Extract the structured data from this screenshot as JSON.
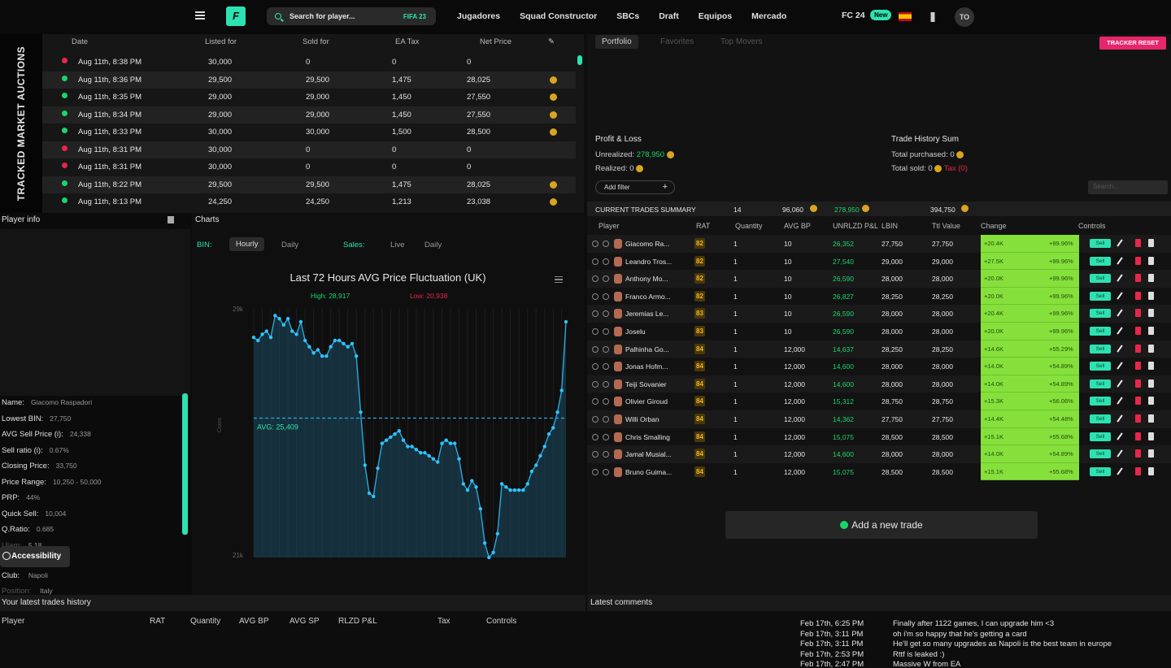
{
  "nav": {
    "search_placeholder": "Search for player...",
    "version": "FIFA 23",
    "links": [
      "Jugadores",
      "Squad Constructor",
      "SBCs",
      "Draft",
      "Equipos",
      "Mercado"
    ],
    "fc_label": "FC 24",
    "new_badge": "New",
    "avatar_initials": "TO"
  },
  "auctions": {
    "banner": "TRACKED MARKET AUCTIONS",
    "headers": [
      "Date",
      "Listed for",
      "Sold for",
      "EA Tax",
      "Net Price"
    ],
    "rows": [
      {
        "status": "red",
        "date": "Aug 11th, 8:38 PM",
        "listed": "30,000",
        "sold": "0",
        "tax": "0",
        "net": "0",
        "coin": false
      },
      {
        "status": "green",
        "date": "Aug 11th, 8:36 PM",
        "listed": "29,500",
        "sold": "29,500",
        "tax": "1,475",
        "net": "28,025",
        "coin": true
      },
      {
        "status": "green",
        "date": "Aug 11th, 8:35 PM",
        "listed": "29,000",
        "sold": "29,000",
        "tax": "1,450",
        "net": "27,550",
        "coin": true
      },
      {
        "status": "green",
        "date": "Aug 11th, 8:34 PM",
        "listed": "29,000",
        "sold": "29,000",
        "tax": "1,450",
        "net": "27,550",
        "coin": true
      },
      {
        "status": "green",
        "date": "Aug 11th, 8:33 PM",
        "listed": "30,000",
        "sold": "30,000",
        "tax": "1,500",
        "net": "28,500",
        "coin": true
      },
      {
        "status": "red",
        "date": "Aug 11th, 8:31 PM",
        "listed": "30,000",
        "sold": "0",
        "tax": "0",
        "net": "0",
        "coin": false
      },
      {
        "status": "red",
        "date": "Aug 11th, 8:31 PM",
        "listed": "30,000",
        "sold": "0",
        "tax": "0",
        "net": "0",
        "coin": false
      },
      {
        "status": "green",
        "date": "Aug 11th, 8:22 PM",
        "listed": "29,500",
        "sold": "29,500",
        "tax": "1,475",
        "net": "28,025",
        "coin": true
      },
      {
        "status": "green",
        "date": "Aug 11th, 8:13 PM",
        "listed": "24,250",
        "sold": "24,250",
        "tax": "1,213",
        "net": "23,038",
        "coin": true
      }
    ]
  },
  "player_info": {
    "title": "Player info",
    "stats": [
      {
        "label": "Name:",
        "value": "Giacomo Raspadori"
      },
      {
        "label": "Lowest BIN:",
        "value": "27,750"
      },
      {
        "label": "AVG Sell Price (i):",
        "value": "24,338"
      },
      {
        "label": "Sell ratio (i):",
        "value": "0.67%"
      },
      {
        "label": "Closing Price:",
        "value": "33,750"
      },
      {
        "label": "Price Range:",
        "value": "10,250 - 50,000"
      },
      {
        "label": "PRP:",
        "value": "44%"
      },
      {
        "label": "Quick Sell:",
        "value": "10,004"
      },
      {
        "label": "Q.Ratio:",
        "value": "0.685"
      },
      {
        "label": "Ulam:",
        "value": "5.18"
      }
    ],
    "club_label": "Club:",
    "club_value": "Napoli",
    "position_label": "Position:",
    "position_value": "Italy",
    "accessibility": "Accessibility"
  },
  "charts": {
    "title": "Charts",
    "bin_label": "BIN:",
    "hourly": "Hourly",
    "daily": "Daily",
    "sales_label": "Sales:",
    "live": "Live",
    "daily2": "Daily",
    "avg_label": "AVG: 25,409",
    "high_label": "High: 28,917",
    "low_label": "Low: 20,938"
  },
  "chart_data": {
    "type": "line",
    "title": "Last 72 Hours AVG Price Fluctuation (UK)",
    "ylabel": "Coins",
    "ylim": [
      20938,
      28917
    ],
    "y_ticks": [
      "29k",
      "21k"
    ],
    "avg": 25409,
    "series": [
      {
        "values": [
          28000,
          27900,
          28100,
          28200,
          28000,
          28700,
          28600,
          28400,
          28600,
          28200,
          28100,
          28500,
          27900,
          27700,
          27500,
          27600,
          27400,
          27400,
          27700,
          27900,
          27900,
          27800,
          27700,
          27800,
          27400,
          25600,
          23900,
          23000,
          22900,
          23800,
          24600,
          24700,
          24800,
          24900,
          25000,
          24700,
          24500,
          24500,
          24400,
          24300,
          24300,
          24200,
          24100,
          24000,
          24600,
          24700,
          24600,
          24600,
          24100,
          23300,
          23100,
          23400,
          23200,
          22500,
          21400,
          20938,
          21100,
          21700,
          23300,
          23200,
          23100,
          23100,
          23100,
          23100,
          23300,
          23700,
          23900,
          24200,
          24500,
          24900,
          25100,
          25600,
          26300,
          28500
        ]
      }
    ]
  },
  "portfolio": {
    "tabs": [
      "Portfolio",
      "Favorites",
      "Top Movers"
    ],
    "reset": "TRACKER RESET",
    "pl_title": "Profit & Loss",
    "unrealized_label": "Unrealized:",
    "unrealized_value": "278,950",
    "realized_label": "Realized:",
    "realized_value": "0",
    "ths_title": "Trade History Sum",
    "purchased_label": "Total purchased:",
    "purchased_value": "0",
    "sold_label": "Total sold:",
    "sold_value": "0",
    "tax_label": "Tax (0)",
    "add_filter": "Add filter",
    "search_placeholder": "Search...",
    "summary": {
      "label": "CURRENT TRADES SUMMARY",
      "count": "14",
      "bp": "96,060",
      "unr": "278,950",
      "total": "394,750"
    },
    "headers": [
      "Player",
      "RAT",
      "Quantity",
      "AVG BP",
      "UNRLZD P&L",
      "LBIN",
      "Ttl Value",
      "Change",
      "Controls"
    ],
    "rows": [
      {
        "name": "Giacomo Ra...",
        "rat": "82",
        "qty": "1",
        "bp": "10",
        "unr": "26,352",
        "lbin": "27,750",
        "ttl": "27,750",
        "chg": "+20.4K",
        "pct": "+99.96%"
      },
      {
        "name": "Leandro Tros...",
        "rat": "82",
        "qty": "1",
        "bp": "10",
        "unr": "27,540",
        "lbin": "29,000",
        "ttl": "29,000",
        "chg": "+27.5K",
        "pct": "+99.96%"
      },
      {
        "name": "Anthony Mo...",
        "rat": "82",
        "qty": "1",
        "bp": "10",
        "unr": "26,590",
        "lbin": "28,000",
        "ttl": "28,000",
        "chg": "+20.0K",
        "pct": "+99.96%"
      },
      {
        "name": "Franco Armo...",
        "rat": "82",
        "qty": "1",
        "bp": "10",
        "unr": "26,827",
        "lbin": "28,250",
        "ttl": "28,250",
        "chg": "+20.0K",
        "pct": "+99.96%"
      },
      {
        "name": "Jeremias Le...",
        "rat": "83",
        "qty": "1",
        "bp": "10",
        "unr": "26,590",
        "lbin": "28,000",
        "ttl": "28,000",
        "chg": "+20.4K",
        "pct": "+99.96%"
      },
      {
        "name": "Joselu",
        "rat": "83",
        "qty": "1",
        "bp": "10",
        "unr": "26,590",
        "lbin": "28,000",
        "ttl": "28,000",
        "chg": "+20.0K",
        "pct": "+99.96%"
      },
      {
        "name": "Palhinha Go...",
        "rat": "84",
        "qty": "1",
        "bp": "12,000",
        "unr": "14,637",
        "lbin": "28,250",
        "ttl": "28,250",
        "chg": "+14.6K",
        "pct": "+55.29%"
      },
      {
        "name": "Jonas Hofm...",
        "rat": "84",
        "qty": "1",
        "bp": "12,000",
        "unr": "14,600",
        "lbin": "28,000",
        "ttl": "28,000",
        "chg": "+14.0K",
        "pct": "+54.89%"
      },
      {
        "name": "Teiji Sovanier",
        "rat": "84",
        "qty": "1",
        "bp": "12,000",
        "unr": "14,600",
        "lbin": "28,000",
        "ttl": "28,000",
        "chg": "+14.0K",
        "pct": "+54.89%"
      },
      {
        "name": "Olivier Giroud",
        "rat": "84",
        "qty": "1",
        "bp": "12,000",
        "unr": "15,312",
        "lbin": "28,750",
        "ttl": "28,750",
        "chg": "+15.3K",
        "pct": "+56.06%"
      },
      {
        "name": "Willi Orban",
        "rat": "84",
        "qty": "1",
        "bp": "12,000",
        "unr": "14,362",
        "lbin": "27,750",
        "ttl": "27,750",
        "chg": "+14.4K",
        "pct": "+54.48%"
      },
      {
        "name": "Chris Smalling",
        "rat": "84",
        "qty": "1",
        "bp": "12,000",
        "unr": "15,075",
        "lbin": "28,500",
        "ttl": "28,500",
        "chg": "+15.1K",
        "pct": "+55.68%"
      },
      {
        "name": "Jamal Musial...",
        "rat": "84",
        "qty": "1",
        "bp": "12,000",
        "unr": "14,600",
        "lbin": "28,000",
        "ttl": "28,000",
        "chg": "+14.0K",
        "pct": "+54.89%"
      },
      {
        "name": "Bruno Guima...",
        "rat": "84",
        "qty": "1",
        "bp": "12,000",
        "unr": "15,075",
        "lbin": "28,500",
        "ttl": "28,500",
        "chg": "+15.1K",
        "pct": "+55.68%"
      }
    ],
    "sell_label": "Sell",
    "add_trade": "Add a new trade"
  },
  "history": {
    "title": "Your latest trades history",
    "cols": [
      "Player",
      "RAT",
      "Quantity",
      "AVG BP",
      "AVG SP",
      "RLZD P&L",
      "Tax",
      "Controls"
    ]
  },
  "comments": {
    "title": "Latest comments",
    "items": [
      {
        "time": "Feb 17th, 6:25 PM",
        "text": "Finally after 1122 games, I can upgrade him <3"
      },
      {
        "time": "Feb 17th, 3:11 PM",
        "text": "oh i'm so happy that he's getting a card"
      },
      {
        "time": "Feb 17th, 3:11 PM",
        "text": "He'll get so many upgrades as Napoli is the best team in europe"
      },
      {
        "time": "Feb 17th, 2:53 PM",
        "text": "Rttf is leaked :)"
      },
      {
        "time": "Feb 17th, 2:47 PM",
        "text": "Massive W from EA"
      }
    ]
  },
  "colors": {
    "accent": "#2de2b0",
    "positive": "#1bd56b",
    "negative": "#e8264b",
    "change_bg": "#86e03c",
    "coin": "#d9a520"
  }
}
